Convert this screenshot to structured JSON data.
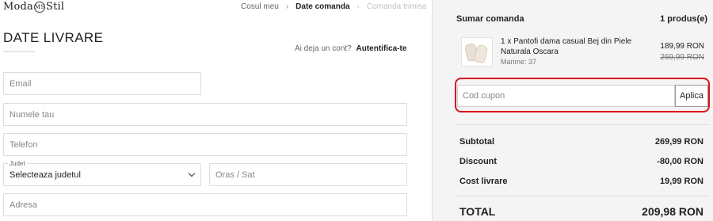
{
  "header": {
    "logo_left": "Moda",
    "logo_mark": "MS",
    "logo_right": "Stil",
    "breadcrumb": [
      {
        "label": "Cosul meu",
        "state": "done"
      },
      {
        "label": "Date comanda",
        "state": "current"
      },
      {
        "label": "Comanda trimisa",
        "state": "disabled"
      }
    ],
    "separator_icon": "chevron-right-icon"
  },
  "delivery": {
    "title": "DATE LIVRARE",
    "login_prompt": "Ai deja un cont?",
    "login_link": "Autentifica-te",
    "fields": {
      "email_placeholder": "Email",
      "name_placeholder": "Numele tau",
      "phone_placeholder": "Telefon",
      "county_label": "Judet",
      "county_value": "Selecteaza judetul",
      "city_placeholder": "Oras / Sat",
      "address_placeholder": "Adresa"
    }
  },
  "summary": {
    "title": "Sumar comanda",
    "count": "1 produs(e)",
    "product": {
      "name": "1 x Pantofi dama casual Bej din Piele Naturala Oscara",
      "size": "Marime: 37",
      "price_now": "189,99 RON",
      "price_old": "269,99 RON"
    },
    "coupon": {
      "placeholder": "Cod cupon",
      "button": "Aplica",
      "highlight_color": "#d9141f"
    },
    "totals": [
      {
        "label": "Subtotal",
        "value": "269,99 RON"
      },
      {
        "label": "Discount",
        "value": "-80,00 RON"
      },
      {
        "label": "Cost livrare",
        "value": "19,99 RON"
      }
    ],
    "grand_total": {
      "label": "TOTAL",
      "value": "209,98 RON"
    }
  }
}
